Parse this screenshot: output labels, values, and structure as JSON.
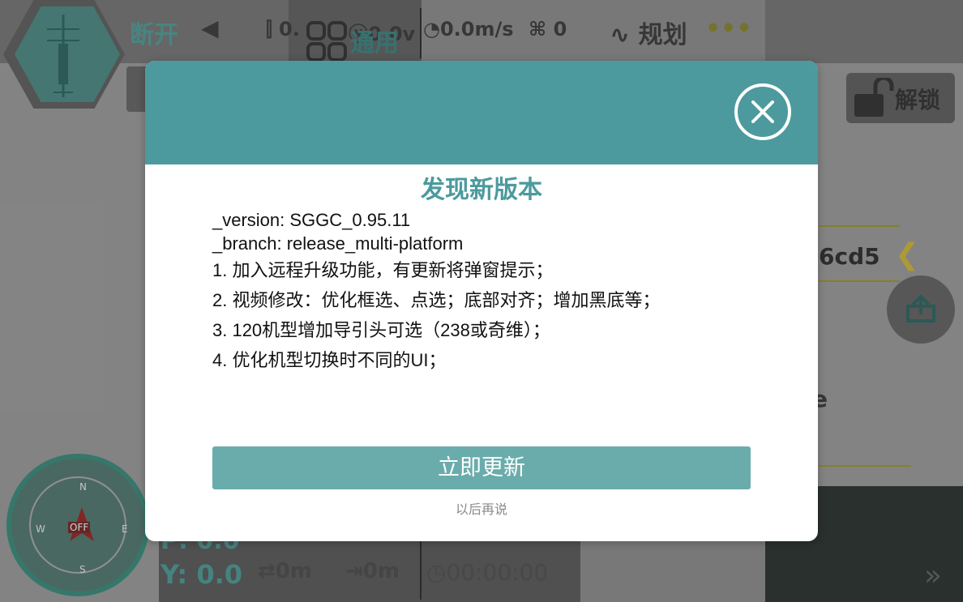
{
  "background": {
    "status_disconnect": "断开",
    "altitude": "0.",
    "voltage": "0.0v",
    "speed": "0.0m/s",
    "satellites": "0",
    "plan_label": "规划",
    "more": "•••",
    "tab_general": "通用",
    "unlock_label": "解锁",
    "device_id_fragment": "6cd5",
    "partial_letter": "e",
    "compass": {
      "n": "N",
      "e": "E",
      "s": "S",
      "w": "W",
      "off": "OFF"
    },
    "pitch": "P: 0.0",
    "yaw": "Y: 0.0",
    "distance1": "0m",
    "distance2": "0m",
    "timer": "00:00:00"
  },
  "dialog": {
    "title": "发现新版本",
    "version_line": "_version: SGGC_0.95.11",
    "branch_line": "_branch:  release_multi-platform",
    "changes": [
      "1. 加入远程升级功能，有更新将弹窗提示；",
      "2. 视频修改：优化框选、点选；底部对齐；增加黑底等；",
      "3. 120机型增加导引头可选（238或奇维）；",
      "4. 优化机型切换时不同的UI；"
    ],
    "update_button": "立即更新",
    "later_link": "以后再说"
  },
  "colors": {
    "accent": "#4c9a9d",
    "button": "#6aacac"
  }
}
